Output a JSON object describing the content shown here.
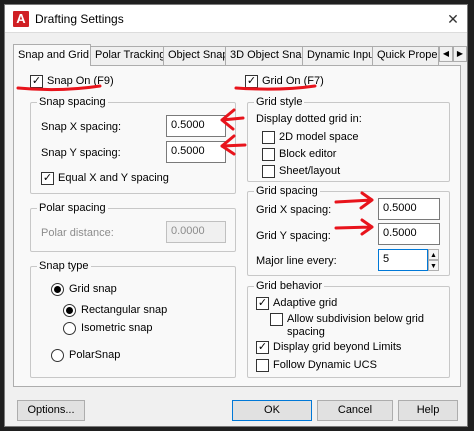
{
  "window": {
    "title": "Drafting Settings",
    "app_icon_letter": "A",
    "close_glyph": "✕"
  },
  "tabs": [
    {
      "label": "Snap and Grid",
      "active": true
    },
    {
      "label": "Polar Tracking"
    },
    {
      "label": "Object Snap"
    },
    {
      "label": "3D Object Snap"
    },
    {
      "label": "Dynamic Input"
    },
    {
      "label": "Quick Propert"
    }
  ],
  "snap_on": {
    "label": "Snap On (F9)",
    "checked": true
  },
  "grid_on": {
    "label": "Grid On (F7)",
    "checked": true
  },
  "snap_spacing": {
    "title": "Snap spacing",
    "x_label": "Snap X spacing:",
    "x_value": "0.5000",
    "y_label": "Snap Y spacing:",
    "y_value": "0.5000",
    "equal_label": "Equal X and Y spacing",
    "equal_checked": true
  },
  "polar_spacing": {
    "title": "Polar spacing",
    "distance_label": "Polar distance:",
    "distance_value": "0.0000"
  },
  "snap_type": {
    "title": "Snap type",
    "grid_snap": "Grid snap",
    "rectangular": "Rectangular snap",
    "isometric": "Isometric snap",
    "polar": "PolarSnap"
  },
  "grid_style": {
    "title": "Grid style",
    "intro": "Display dotted grid in:",
    "model_space": "2D model space",
    "block_editor": "Block editor",
    "sheet_layout": "Sheet/layout"
  },
  "grid_spacing": {
    "title": "Grid spacing",
    "x_label": "Grid X spacing:",
    "x_value": "0.5000",
    "y_label": "Grid Y spacing:",
    "y_value": "0.5000",
    "major_label": "Major line every:",
    "major_value": "5"
  },
  "grid_behavior": {
    "title": "Grid behavior",
    "adaptive": "Adaptive grid",
    "subdivision_1": "Allow subdivision below grid",
    "subdivision_2": "spacing",
    "beyond_limits": "Display grid beyond Limits",
    "follow_ucs": "Follow Dynamic UCS"
  },
  "buttons": {
    "options": "Options...",
    "ok": "OK",
    "cancel": "Cancel",
    "help": "Help"
  },
  "annotation_color": "#e8141c",
  "check_glyph": "✓"
}
